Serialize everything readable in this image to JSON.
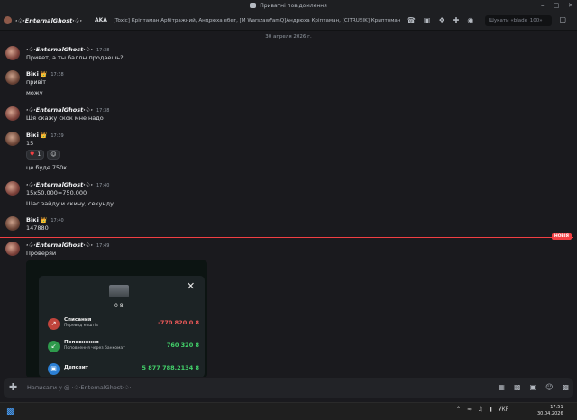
{
  "window": {
    "title": "Приватні повідомлення"
  },
  "header": {
    "name": "·♤·EnternalGhost·♤·",
    "aka": "AKA",
    "aliases": "[Toxic] Кріптаман Арбітражний, Андрюха ебет, [M WarszawFamQ]Андрюха Кріптаман, [CITRUSIK] Криптоман Турбиков...",
    "search_placeholder": "Шукати «blade_100»"
  },
  "chat": {
    "date_divider": "30 апреля 2026 г.",
    "new_label": "НОВІЯ",
    "messages": [
      {
        "author": "·♤·EnternalGhost·♤·",
        "time": "17:38",
        "lines": [
          "Привет, а ты баллы продаешь?"
        ]
      },
      {
        "author": "Вікі",
        "badge": "👑",
        "time": "17:38",
        "lines": [
          "привіт",
          "можу"
        ]
      },
      {
        "author": "·♤·EnternalGhost·♤·",
        "time": "17:38",
        "lines": [
          "Щя скажу скок мне надо"
        ]
      },
      {
        "author": "Вікі",
        "badge": "👑",
        "time": "17:39",
        "lines": [
          "15",
          "це буде 750к"
        ],
        "reactions": [
          {
            "emoji": "♥",
            "count": "1"
          },
          {
            "emoji": "☺",
            "count": ""
          }
        ]
      },
      {
        "author": "·♤·EnternalGhost·♤·",
        "time": "17:40",
        "lines": [
          "15x50.000=750.000",
          "Щас зайду и скину, секунду"
        ]
      },
      {
        "author": "Вікі",
        "badge": "👑",
        "time": "17:40",
        "lines": [
          "147880"
        ]
      },
      {
        "author": "·♤·EnternalGhost·♤·",
        "time": "17:49",
        "lines": [
          "Проверяй"
        ]
      }
    ],
    "attachment": {
      "balance": "0 8",
      "transactions": [
        {
          "title": "Списания",
          "sub": "Перевод коштів",
          "amount": "-770 820.0 8",
          "color": "#f05a5a",
          "icon_bg": "#c0443c",
          "icon": "↗"
        },
        {
          "title": "Поповнення",
          "sub": "Поповнення через банкомат",
          "amount": "760 320 8",
          "color": "#43d46b",
          "icon_bg": "#2e9a4c",
          "icon": "↙"
        },
        {
          "title": "Депозит",
          "sub": "",
          "amount": "5 877 788.2134 8",
          "color": "#43d46b",
          "icon_bg": "#2b7fd4",
          "icon": "▣"
        }
      ]
    }
  },
  "composer": {
    "placeholder": "Написати у @ ·♤·EnternalGhost·♤·"
  },
  "taskbar": {
    "lang": "УКР",
    "time": "17:51",
    "date": "30.04.2026"
  }
}
